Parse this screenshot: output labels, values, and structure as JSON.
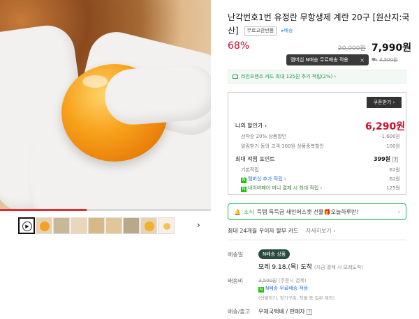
{
  "product": {
    "title": "난각번호1번 유정란 무항생제 계란 20구 [원산지:국산]",
    "return_badge": "무료교환반품",
    "delivery_badge": "배송",
    "discount_rate": "68%",
    "original_price": "20,000원",
    "sale_price": "7,990원"
  },
  "tooltip": {
    "text": "멤버십 N배송 무료배송 적용",
    "close": "×",
    "mini_price": "3,500원"
  },
  "card_promo": {
    "text": "라인프렌즈 카드 최대 125원 추가 적립(2%) ›"
  },
  "benefits": {
    "coupon_button": "쿠폰받기 ›",
    "my_discount_label": "나의 할인가 ›",
    "my_discount_value": "6,290원",
    "rows": [
      {
        "label": "선착순 20% 상품할인",
        "value": "-1,600원"
      },
      {
        "label": "알림받기 동의 고객 100원 상품중복할인",
        "value": "-100원"
      }
    ],
    "point_label": "최대 적립 포인트",
    "point_value": "399원",
    "point_help": "?",
    "point_rows": [
      {
        "label": "기본적립",
        "value": "62원"
      },
      {
        "label": "멤버십 추가 적립 ›",
        "value": "62원"
      },
      {
        "label": "네이버페이 머니 결제 시 최대 적립 ›",
        "value": "125원"
      }
    ]
  },
  "news": {
    "tag": "소식",
    "text": "득템 특득급 새인머스캣 선물🎁오늘하루만!"
  },
  "installment": {
    "text": "최대 24개월 무이자 할부 카드",
    "more": "자세히보기 ›"
  },
  "shipping": {
    "date_label": "배송일",
    "badge": "N배송 상품",
    "arrival": "모레 9.18.(목) 도착",
    "arrival_note": "(지금 결제 시 모레도착)",
    "fee_label": "배송비",
    "fee_original": "3,500원",
    "fee_note": "(주문시 결제)",
    "fee_member": "N배송 무료배송 적용",
    "fee_sub": "(선물하기, 정기구독, 착불 등 일부 제외)",
    "carrier_label": "배송/출고",
    "carrier": "우체국택배 / 판매자",
    "carrier_help": "?"
  },
  "gallery": {
    "progress": 0.41,
    "next": "›"
  },
  "colors": {
    "accent_red": "#c8102e",
    "green": "#2ab060",
    "naver_green": "#1ec800"
  },
  "icons": [
    "play-icon",
    "bell-icon",
    "card-icon",
    "chevron-right-icon",
    "close-icon"
  ]
}
